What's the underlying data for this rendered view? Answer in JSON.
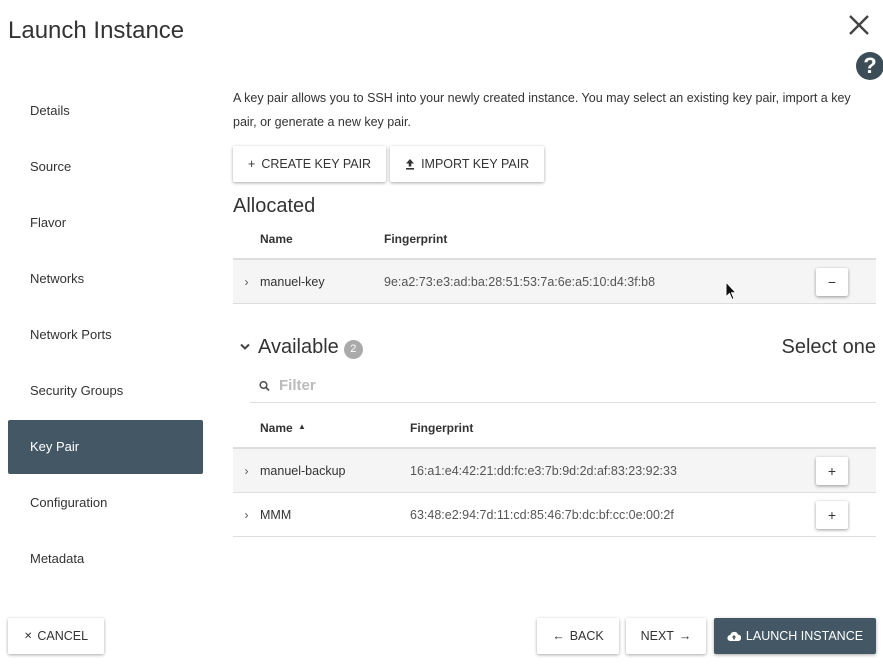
{
  "modal": {
    "title": "Launch Instance",
    "help_label": "?"
  },
  "sidebar": {
    "items": [
      {
        "label": "Details"
      },
      {
        "label": "Source"
      },
      {
        "label": "Flavor"
      },
      {
        "label": "Networks"
      },
      {
        "label": "Network Ports"
      },
      {
        "label": "Security Groups"
      },
      {
        "label": "Key Pair",
        "active": true
      },
      {
        "label": "Configuration"
      },
      {
        "label": "Metadata"
      }
    ]
  },
  "main": {
    "description": "A key pair allows you to SSH into your newly created instance. You may select an existing key pair, import a key pair, or generate a new key pair.",
    "create_button": {
      "icon": "+",
      "label": "CREATE KEY PAIR"
    },
    "import_button": {
      "icon": "upload-icon",
      "label": "IMPORT KEY PAIR"
    }
  },
  "allocated": {
    "title": "Allocated",
    "columns": [
      "Name",
      "Fingerprint"
    ],
    "rows": [
      {
        "name": "manuel-key",
        "fingerprint": "9e:a2:73:e3:ad:ba:28:51:53:7a:6e:a5:10:d4:3f:b8",
        "action": "−"
      }
    ]
  },
  "available": {
    "title": "Available",
    "count": "2",
    "select_hint": "Select one",
    "filter_placeholder": "Filter",
    "columns": [
      "Name",
      "Fingerprint"
    ],
    "sort_indicator": "▲",
    "rows": [
      {
        "name": "manuel-backup",
        "fingerprint": "16:a1:e4:42:21:dd:fc:e3:7b:9d:2d:af:83:23:92:33",
        "action": "+"
      },
      {
        "name": "MMM",
        "fingerprint": "63:48:e2:94:7d:11:cd:85:46:7b:dc:bf:cc:0e:00:2f",
        "action": "+"
      }
    ]
  },
  "footer": {
    "cancel": {
      "icon": "✕",
      "label": "CANCEL"
    },
    "back": {
      "icon": "←",
      "label": "BACK"
    },
    "next": {
      "icon": "→",
      "label": "NEXT"
    },
    "launch": {
      "icon": "cloud-upload-icon",
      "label": "LAUNCH INSTANCE"
    }
  },
  "colors": {
    "accent": "#435864",
    "help_bg": "#3d4d57",
    "badge": "#aaaaaa"
  }
}
